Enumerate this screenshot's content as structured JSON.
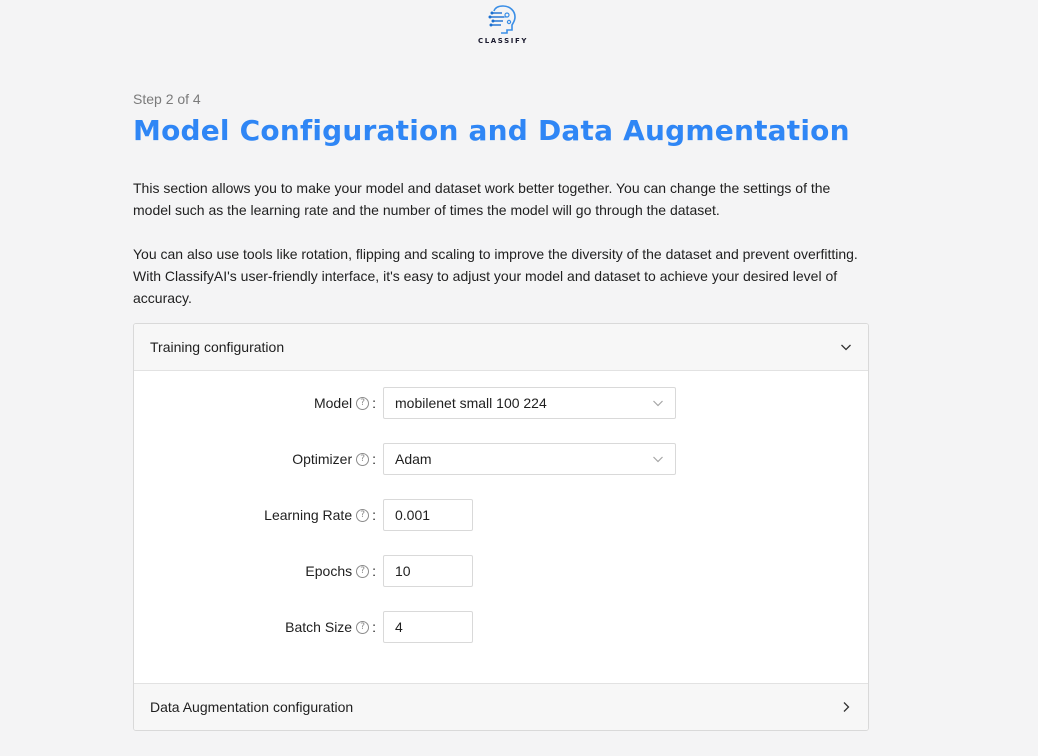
{
  "logo": {
    "text": "CLASSIFY",
    "icon": "brain-circuit-icon"
  },
  "header": {
    "step": "Step 2 of 4",
    "title": "Model Configuration and Data Augmentation"
  },
  "intro": {
    "paragraph1": "This section allows you to make your model and dataset work better together. You can change the settings of the model such as the learning rate and the number of times the model will go through the dataset.",
    "paragraph2": "You can also use tools like rotation, flipping and scaling to improve the diversity of the dataset and prevent overfitting. With ClassifyAI's user-friendly interface, it's easy to adjust your model and dataset to achieve your desired level of accuracy."
  },
  "training_config": {
    "label": "Training configuration",
    "expanded": true,
    "fields": {
      "model": {
        "label": "Model",
        "value": "mobilenet small 100 224"
      },
      "optimizer": {
        "label": "Optimizer",
        "value": "Adam"
      },
      "learning_rate": {
        "label": "Learning Rate",
        "value": "0.001"
      },
      "epochs": {
        "label": "Epochs",
        "value": "10"
      },
      "batch_size": {
        "label": "Batch Size",
        "value": "4"
      }
    },
    "help_glyph": "?",
    "colon": ":"
  },
  "augmentation_config": {
    "label": "Data Augmentation configuration",
    "expanded": false
  },
  "colors": {
    "accent": "#2f86f5",
    "background": "#f4f4f5",
    "panel_header": "#f7f7f7",
    "border": "#d9d9d9"
  }
}
